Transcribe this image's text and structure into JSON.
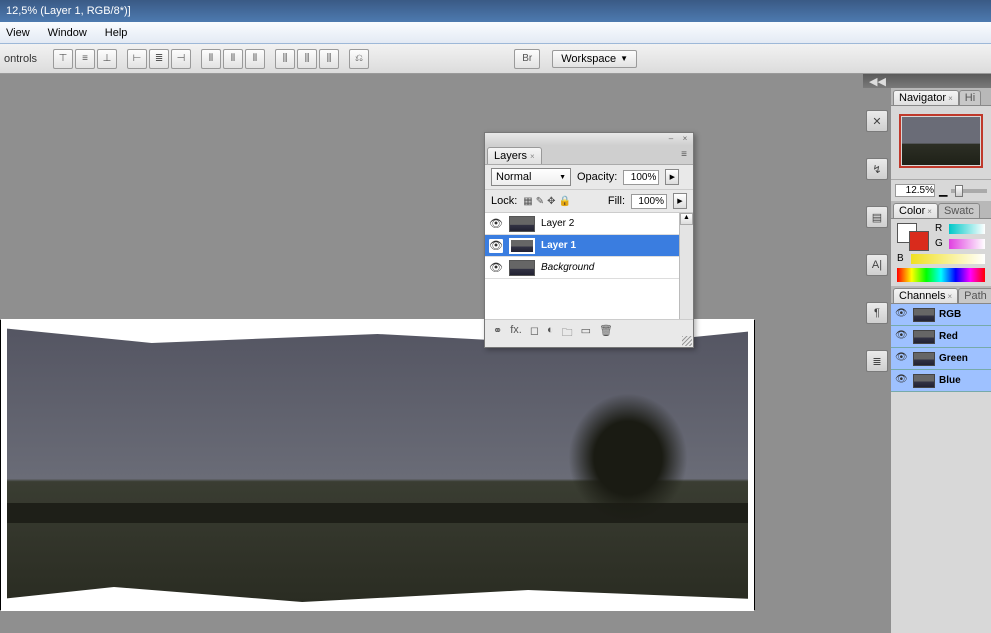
{
  "title": "12,5% (Layer 1, RGB/8*)]",
  "menu": {
    "view": "View",
    "window": "Window",
    "help": "Help"
  },
  "optionsbar": {
    "label": "ontrols",
    "workspace": "Workspace"
  },
  "layers_panel": {
    "tab": "Layers",
    "blend_mode": "Normal",
    "opacity_label": "Opacity:",
    "opacity_value": "100%",
    "lock_label": "Lock:",
    "fill_label": "Fill:",
    "fill_value": "100%",
    "layers": [
      {
        "name": "Layer 2",
        "selected": false,
        "locked": false,
        "italic": false
      },
      {
        "name": "Layer 1",
        "selected": true,
        "locked": false,
        "italic": false
      },
      {
        "name": "Background",
        "selected": false,
        "locked": true,
        "italic": true
      }
    ]
  },
  "navigator": {
    "tab1": "Navigator",
    "tab2": "Hi",
    "zoom": "12.5%"
  },
  "color": {
    "tab1": "Color",
    "tab2": "Swatc",
    "r": "R",
    "g": "G",
    "b": "B"
  },
  "channels": {
    "tab1": "Channels",
    "tab2": "Path",
    "rows": [
      "RGB",
      "Red",
      "Green",
      "Blue"
    ]
  }
}
